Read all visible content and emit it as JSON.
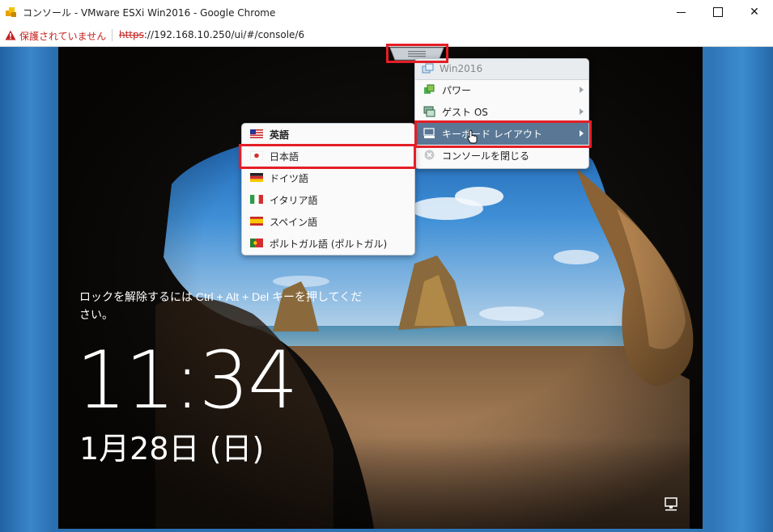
{
  "window": {
    "title": "コンソール - VMware ESXi Win2016 - Google Chrome",
    "minimize": "",
    "maximize": "",
    "close": "✕"
  },
  "address_bar": {
    "security_text": "保護されていません",
    "url_scheme": "https",
    "url_rest": "://192.168.10.250/ui/#/console/6"
  },
  "lock_screen": {
    "message": "ロックを解除するには Ctrl + Alt + Del キーを押してください。",
    "time": "11:34",
    "date": "1月28日 (日)"
  },
  "vm_menu": {
    "header": "Win2016",
    "items": [
      {
        "label": "パワー",
        "icon": "power-icon",
        "has_submenu": true
      },
      {
        "label": "ゲスト OS",
        "icon": "guest-os-icon",
        "has_submenu": true
      },
      {
        "label": "キーボード レイアウト",
        "icon": "keyboard-icon",
        "has_submenu": true,
        "active": true
      },
      {
        "label": "コンソールを閉じる",
        "icon": "close-circle-icon",
        "has_submenu": false
      }
    ]
  },
  "keyboard_submenu": {
    "items": [
      {
        "label": "英語",
        "flag": "us-flag-icon",
        "selected": true
      },
      {
        "label": "日本語",
        "flag": "japan-flag-icon"
      },
      {
        "label": "ドイツ語",
        "flag": "germany-flag-icon"
      },
      {
        "label": "イタリア語",
        "flag": "italy-flag-icon"
      },
      {
        "label": "スペイン語",
        "flag": "spain-flag-icon"
      },
      {
        "label": "ポルトガル語 (ポルトガル)",
        "flag": "portugal-flag-icon"
      }
    ]
  },
  "colors": {
    "highlight_box": "#e41e26",
    "menu_active": "#5a7896",
    "warning": "#c5221f"
  }
}
